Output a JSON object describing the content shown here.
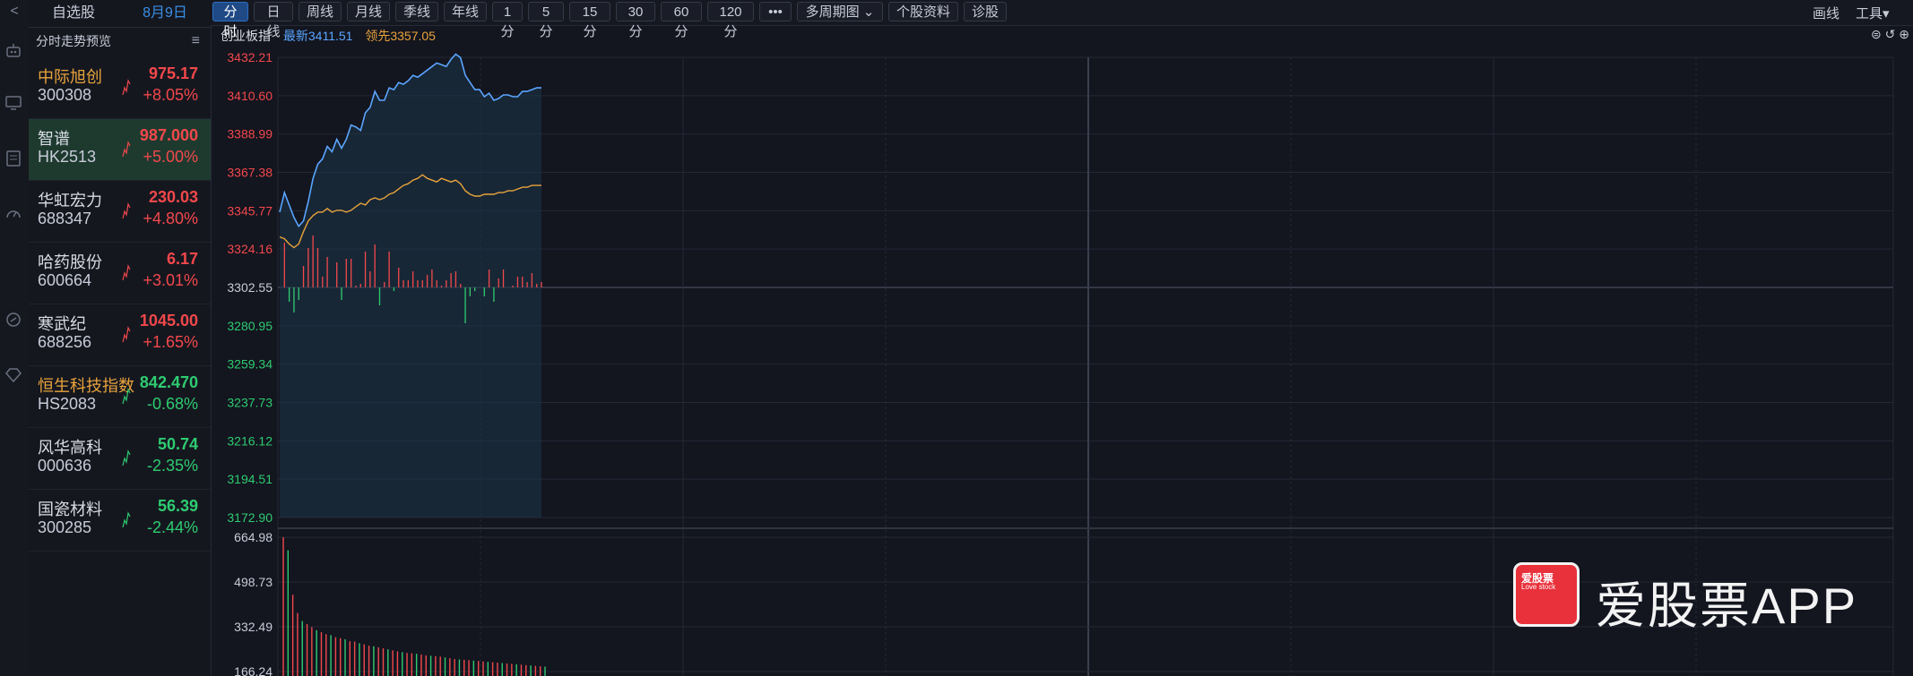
{
  "rail": {
    "collapse_label": "<"
  },
  "watchlist": {
    "tab_watch": "自选股",
    "tab_date": "8月9日",
    "preview_title": "分时走势预览",
    "items": [
      {
        "name": "中际旭创",
        "code": "300308",
        "price": "975.17",
        "change": "+8.05%",
        "dir": "up",
        "name_color": "orange"
      },
      {
        "name": "智谱",
        "code": "HK2513",
        "price": "987.000",
        "change": "+5.00%",
        "dir": "up",
        "selected": true
      },
      {
        "name": "华虹宏力",
        "code": "688347",
        "price": "230.03",
        "change": "+4.80%",
        "dir": "up"
      },
      {
        "name": "哈药股份",
        "code": "600664",
        "price": "6.17",
        "change": "+3.01%",
        "dir": "up"
      },
      {
        "name": "寒武纪",
        "code": "688256",
        "price": "1045.00",
        "change": "+1.65%",
        "dir": "up"
      },
      {
        "name": "恒生科技指数",
        "code": "HS2083",
        "price": "842.470",
        "change": "-0.68%",
        "dir": "down",
        "name_color": "orange"
      },
      {
        "name": "风华高科",
        "code": "000636",
        "price": "50.74",
        "change": "-2.35%",
        "dir": "down"
      },
      {
        "name": "国瓷材料",
        "code": "300285",
        "price": "56.39",
        "change": "-2.44%",
        "dir": "down"
      }
    ]
  },
  "toolbar": {
    "buttons": [
      "分时",
      "日线",
      "周线",
      "月线",
      "季线",
      "年线",
      "1分",
      "5分",
      "15分",
      "30分",
      "60分",
      "120分",
      "•••",
      "多周期图 ⌄",
      "个股资料",
      "诊股"
    ],
    "active": "分时",
    "right_draw": "画线",
    "right_tools": "工具▾"
  },
  "chart_header": {
    "title": "创业板指",
    "latest": "最新3411.51",
    "leading": "领先3357.05"
  },
  "colors": {
    "price_line": "#5aa5ff",
    "avg_line": "#e8a33c",
    "up": "#f2484b",
    "down": "#2ecc71",
    "grid": "#2a2e3a"
  },
  "chart_data": {
    "type": "line",
    "title": "创业板指",
    "price_axis_ticks": [
      "3432.21",
      "3410.60",
      "3388.99",
      "3367.38",
      "3345.77",
      "3324.16",
      "3302.55",
      "3280.95",
      "3259.34",
      "3237.73",
      "3216.12",
      "3194.51",
      "3172.90"
    ],
    "volume_axis_ticks": [
      "664.98",
      "498.73",
      "332.49",
      "166.24"
    ],
    "ylim": [
      3172.9,
      3432.21
    ],
    "base": 3302.55,
    "series": [
      {
        "values": [
          3345,
          3356,
          3349,
          3342,
          3337,
          3340,
          3351,
          3364,
          3372,
          3375,
          3382,
          3379,
          3386,
          3381,
          3386,
          3394,
          3393,
          3391,
          3401,
          3404,
          3413,
          3408,
          3408,
          3415,
          3414,
          3418,
          3417,
          3419,
          3422,
          3421,
          3423,
          3425,
          3427,
          3429,
          3428,
          3427,
          3431,
          3434,
          3432,
          3422,
          3418,
          3414,
          3414,
          3410,
          3412,
          3408,
          3409,
          3411,
          3411,
          3410,
          3410,
          3413,
          3413,
          3414,
          3415,
          3415
        ]
      },
      {
        "values": [
          3331,
          3330,
          3327,
          3325,
          3327,
          3334,
          3340,
          3343,
          3345,
          3345,
          3347,
          3345,
          3346,
          3346,
          3345,
          3346,
          3348,
          3350,
          3349,
          3352,
          3353,
          3352,
          3353,
          3355,
          3356,
          3358,
          3360,
          3361,
          3363,
          3364,
          3366,
          3364,
          3363,
          3362,
          3364,
          3363,
          3362,
          3363,
          3361,
          3357,
          3355,
          3354,
          3354,
          3355,
          3355,
          3355,
          3356,
          3356,
          3357,
          3357,
          3358,
          3359,
          3359,
          3360,
          3360,
          3360
        ]
      }
    ],
    "volume_values": [
      664.98,
      600,
      380,
      290,
      250,
      235,
      220,
      205,
      195,
      185,
      180,
      170,
      165,
      160,
      150,
      148,
      140,
      135,
      128,
      125,
      120,
      115,
      110,
      105,
      100,
      96,
      92,
      90,
      88,
      84,
      80,
      78,
      76,
      74,
      70,
      66,
      62,
      60,
      58,
      56,
      54,
      52,
      50,
      48,
      46,
      44,
      42,
      40,
      38,
      36,
      34,
      32,
      30,
      28,
      26,
      24
    ]
  },
  "watermark": {
    "brand": "爱股票APP",
    "logo_line1": "爱股票",
    "logo_line2": "Love stock"
  }
}
